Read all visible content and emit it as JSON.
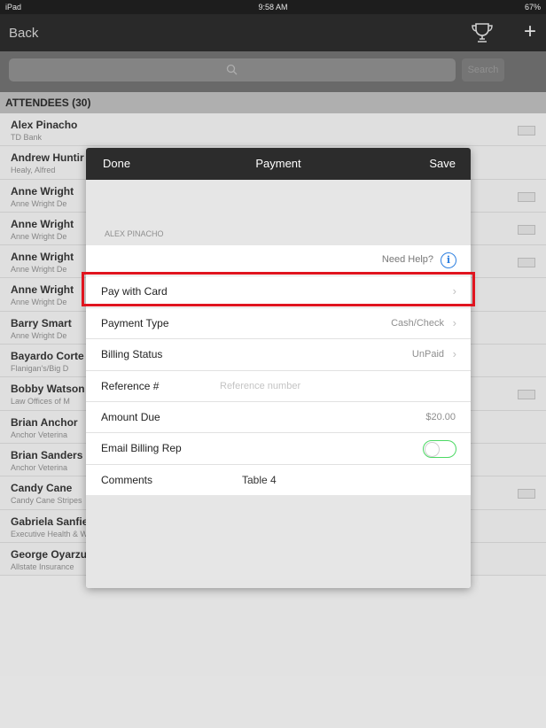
{
  "statusbar": {
    "left": "iPad",
    "time": "9:58 AM",
    "right": "67%"
  },
  "navbar": {
    "back": "Back",
    "trophy_icon": "trophy-icon",
    "plus": "+"
  },
  "search": {
    "placeholder": "",
    "button": "Search"
  },
  "section": {
    "title": "ATTENDEES (30)"
  },
  "attendees": [
    {
      "name": "Alex Pinacho",
      "org": "TD Bank",
      "tag": true
    },
    {
      "name": "Andrew Huntir",
      "org": "Healy, Alfred",
      "tag": false
    },
    {
      "name": "Anne Wright",
      "org": "Anne Wright De",
      "tag": true
    },
    {
      "name": "Anne Wright",
      "org": "Anne Wright De",
      "tag": true
    },
    {
      "name": "Anne Wright",
      "org": "Anne Wright De",
      "tag": true
    },
    {
      "name": "Anne Wright",
      "org": "Anne Wright De",
      "tag": false
    },
    {
      "name": "Barry Smart",
      "org": "Anne Wright De",
      "tag": false
    },
    {
      "name": "Bayardo Corte",
      "org": "Flanigan's/Big D",
      "tag": false
    },
    {
      "name": "Bobby Watson",
      "org": "Law Offices of M",
      "tag": true
    },
    {
      "name": "Brian Anchor",
      "org": "Anchor Veterina",
      "tag": false
    },
    {
      "name": "Brian Sanders",
      "org": "Anchor Veterina",
      "tag": false
    },
    {
      "name": "Candy Cane",
      "org": "Candy Cane Stripes",
      "tag": true
    },
    {
      "name": "Gabriela Sanfield",
      "org": "Executive Health & Wealth Institute",
      "tag": false
    },
    {
      "name": "George Oyarzun",
      "org": "Allstate Insurance",
      "tag": false
    }
  ],
  "modal": {
    "done": "Done",
    "title": "Payment",
    "save": "Save",
    "attendee_name": "ALEX PINACHO",
    "help": "Need Help?",
    "pay_with_card": "Pay with Card",
    "payment_type_label": "Payment Type",
    "payment_type_value": "Cash/Check",
    "billing_status_label": "Billing Status",
    "billing_status_value": "UnPaid",
    "reference_label": "Reference #",
    "reference_placeholder": "Reference number",
    "amount_due_label": "Amount Due",
    "amount_due_value": "$20.00",
    "email_billing_rep_label": "Email Billing Rep",
    "email_billing_rep_on": false,
    "comments_label": "Comments",
    "comments_value": "Table 4"
  },
  "colors": {
    "highlight": "#e0141f",
    "toggle": "#4cd964",
    "info": "#2c7fe0"
  }
}
